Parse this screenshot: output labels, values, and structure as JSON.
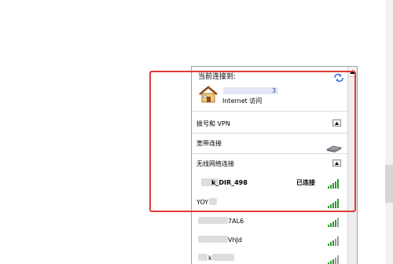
{
  "network_panel": {
    "current_connection_label": "当前连接到:",
    "internet_text": "Internet 访问",
    "dialup_section": "拨号和 VPN",
    "broadband_section": "宽带连接",
    "wireless_section": "无线网络连接",
    "networks": [
      {
        "name": "k_DIR_498",
        "status": "已连接"
      },
      {
        "name": "YOY",
        "status": ""
      },
      {
        "name": "7AL6",
        "status": ""
      },
      {
        "name": "VhJd",
        "status": ""
      },
      {
        "name": "k",
        "status": ""
      }
    ]
  },
  "colors": {
    "highlight_border": "#e03a3a",
    "signal_green": "#2e9b2e"
  },
  "icons": {
    "refresh": "refresh-icon",
    "home_network": "home-network-icon",
    "broadband": "broadband-icon",
    "collapse": "chevron-up-icon",
    "signal": "wifi-signal-icon"
  }
}
